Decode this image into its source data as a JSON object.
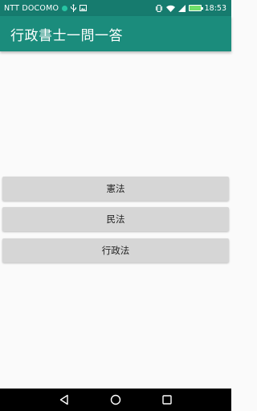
{
  "status_bar": {
    "carrier": "NTT DOCOMO",
    "time": "18:53"
  },
  "app_bar": {
    "title": "行政書士一問一答"
  },
  "subjects": [
    {
      "label": "憲法"
    },
    {
      "label": "民法"
    },
    {
      "label": "行政法"
    }
  ],
  "colors": {
    "status_bar": "#167b6e",
    "app_bar": "#1b8c7c",
    "button": "#d6d6d6",
    "background": "#fafafa"
  },
  "icons": {
    "status": [
      "notification-dot-icon",
      "usb-icon",
      "image-icon",
      "vibrate-icon",
      "wifi-icon",
      "signal-icon",
      "battery-icon"
    ],
    "nav": [
      "back-icon",
      "home-icon",
      "recents-icon"
    ]
  }
}
